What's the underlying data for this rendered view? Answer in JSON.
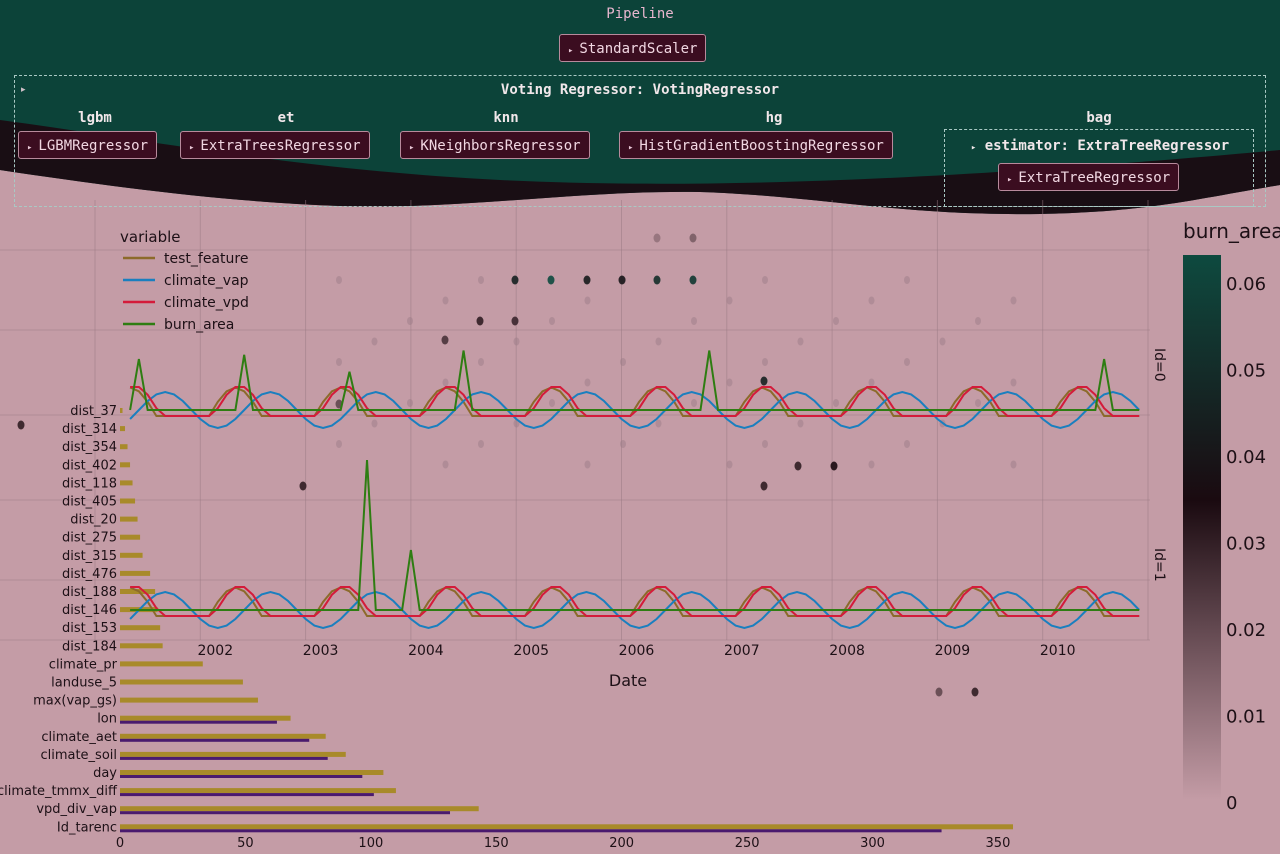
{
  "pipeline": {
    "title": "Pipeline",
    "scaler": "StandardScaler",
    "voting_title": "Voting Regressor: VotingRegressor",
    "estimators": [
      {
        "name": "lgbm",
        "model": "LGBMRegressor"
      },
      {
        "name": "et",
        "model": "ExtraTreesRegressor"
      },
      {
        "name": "knn",
        "model": "KNeighborsRegressor"
      },
      {
        "name": "hg",
        "model": "HistGradientBoostingRegressor"
      },
      {
        "name": "bag",
        "model": "estimator: ExtraTreeRegressor",
        "sub_model": "ExtraTreeRegressor"
      }
    ],
    "collapse_glyph": "▸"
  },
  "colorbar": {
    "title": "burn_area",
    "ticks": [
      "0.06",
      "0.05",
      "0.04",
      "0.03",
      "0.02",
      "0.01",
      "0"
    ],
    "tick_values": [
      0.06,
      0.05,
      0.04,
      0.03,
      0.02,
      0.01,
      0
    ],
    "range": [
      0,
      0.063
    ],
    "colors": [
      "#c49ca6",
      "#1a0a10",
      "#0e4a3f"
    ]
  },
  "chart_data": [
    {
      "type": "line",
      "legend_title": "variable",
      "series_names": [
        "test_feature",
        "climate_vap",
        "climate_vpd",
        "burn_area"
      ],
      "series_colors": [
        "#8c6a2a",
        "#1a7fbf",
        "#d41b3a",
        "#2e7d12"
      ],
      "xlabel": "Date",
      "x_ticks": [
        "2002",
        "2003",
        "2004",
        "2005",
        "2006",
        "2007",
        "2008",
        "2009",
        "2010"
      ],
      "x_range": [
        "2001-01",
        "2010-12"
      ],
      "facets": [
        "Id=0",
        "Id=1"
      ],
      "burn_spikes": [
        {
          "facet": "Id=0",
          "date": "2001-06",
          "value": 0.6
        },
        {
          "facet": "Id=0",
          "date": "2002-06",
          "value": 0.65
        },
        {
          "facet": "Id=0",
          "date": "2003-06",
          "value": 0.45
        },
        {
          "facet": "Id=0",
          "date": "2004-07",
          "value": 0.7
        },
        {
          "facet": "Id=0",
          "date": "2006-11",
          "value": 0.7
        },
        {
          "facet": "Id=0",
          "date": "2010-08",
          "value": 0.6
        },
        {
          "facet": "Id=1",
          "date": "2003-08",
          "value": 1.0
        },
        {
          "facet": "Id=1",
          "date": "2004-01",
          "value": 0.4
        }
      ]
    },
    {
      "type": "bar",
      "orientation": "horizontal",
      "categories": [
        "dist_37",
        "dist_314",
        "dist_354",
        "dist_402",
        "dist_118",
        "dist_405",
        "dist_20",
        "dist_275",
        "dist_315",
        "dist_476",
        "dist_188",
        "dist_146",
        "dist_153",
        "dist_184",
        "climate_pr",
        "landuse_5",
        "max(vap_gs)",
        "lon",
        "climate_aet",
        "climate_soil",
        "day",
        "climate_tmmx_diff",
        "vpd_div_vap",
        "Id_tarenc"
      ],
      "values": [
        1,
        2,
        3,
        4,
        5,
        6,
        7,
        8,
        9,
        12,
        14,
        15,
        16,
        17,
        33,
        49,
        55,
        68,
        82,
        90,
        105,
        110,
        143,
        356
      ],
      "x_ticks": [
        "0",
        "50",
        "100",
        "150",
        "200",
        "250",
        "300",
        "350"
      ],
      "x_tick_values": [
        0,
        50,
        100,
        150,
        200,
        250,
        300,
        350
      ],
      "colors": [
        "#a88a2a",
        "#4a1a6e"
      ]
    },
    {
      "type": "scatter",
      "color_by": "burn_area",
      "note_points": [
        {
          "x": 657,
          "y": 238,
          "value": 0.01
        },
        {
          "x": 693,
          "y": 238,
          "value": 0.015
        },
        {
          "x": 515,
          "y": 280,
          "value": 0.045
        },
        {
          "x": 551,
          "y": 280,
          "value": 0.063
        },
        {
          "x": 587,
          "y": 280,
          "value": 0.042
        },
        {
          "x": 622,
          "y": 280,
          "value": 0.04
        },
        {
          "x": 657,
          "y": 280,
          "value": 0.05
        },
        {
          "x": 693,
          "y": 280,
          "value": 0.055
        },
        {
          "x": 480,
          "y": 321,
          "value": 0.03
        },
        {
          "x": 515,
          "y": 321,
          "value": 0.028
        },
        {
          "x": 445,
          "y": 340,
          "value": 0.025
        },
        {
          "x": 764,
          "y": 381,
          "value": 0.045
        },
        {
          "x": 303,
          "y": 486,
          "value": 0.03
        },
        {
          "x": 764,
          "y": 486,
          "value": 0.03
        },
        {
          "x": 798,
          "y": 466,
          "value": 0.03
        },
        {
          "x": 834,
          "y": 466,
          "value": 0.035
        },
        {
          "x": 21,
          "y": 425,
          "value": 0.03
        },
        {
          "x": 939,
          "y": 692,
          "value": 0.02
        },
        {
          "x": 975,
          "y": 692,
          "value": 0.03
        },
        {
          "x": 339,
          "y": 404,
          "value": 0.02
        }
      ]
    }
  ]
}
